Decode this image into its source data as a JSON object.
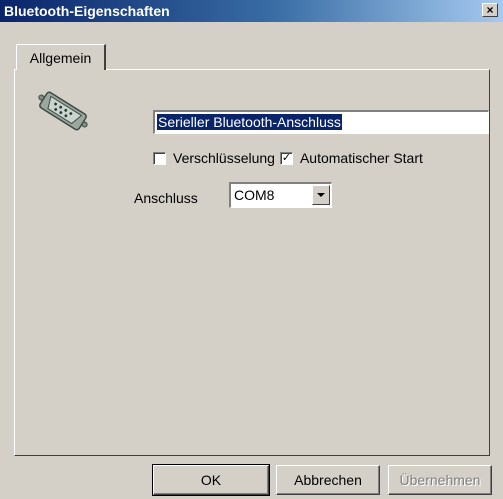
{
  "window": {
    "title": "Bluetooth-Eigenschaften",
    "close_symbol": "×"
  },
  "tabs": [
    {
      "label": "Allgemein",
      "selected": true
    }
  ],
  "general": {
    "icon": "serial-port-icon",
    "name_value": "Serieller Bluetooth-Anschluss",
    "encryption_label": "Verschlüsselung",
    "encryption_checked": false,
    "autostart_label": "Automatischer Start",
    "autostart_checked": true,
    "check_mark": "✓",
    "port_label": "Anschluss",
    "port_value": "COM8"
  },
  "buttons": {
    "ok": "OK",
    "cancel": "Abbrechen",
    "apply": "Übernehmen"
  },
  "colors": {
    "titlebar_start": "#0a246a",
    "face": "#d4d0c8",
    "selection": "#0a246a"
  }
}
